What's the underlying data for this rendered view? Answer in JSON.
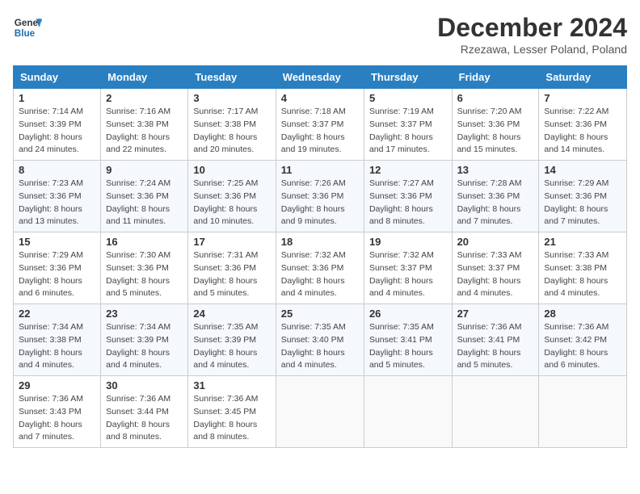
{
  "header": {
    "logo_general": "General",
    "logo_blue": "Blue",
    "month_title": "December 2024",
    "location": "Rzezawa, Lesser Poland, Poland"
  },
  "days_of_week": [
    "Sunday",
    "Monday",
    "Tuesday",
    "Wednesday",
    "Thursday",
    "Friday",
    "Saturday"
  ],
  "weeks": [
    [
      {
        "day": "1",
        "sunrise": "Sunrise: 7:14 AM",
        "sunset": "Sunset: 3:39 PM",
        "daylight": "Daylight: 8 hours and 24 minutes."
      },
      {
        "day": "2",
        "sunrise": "Sunrise: 7:16 AM",
        "sunset": "Sunset: 3:38 PM",
        "daylight": "Daylight: 8 hours and 22 minutes."
      },
      {
        "day": "3",
        "sunrise": "Sunrise: 7:17 AM",
        "sunset": "Sunset: 3:38 PM",
        "daylight": "Daylight: 8 hours and 20 minutes."
      },
      {
        "day": "4",
        "sunrise": "Sunrise: 7:18 AM",
        "sunset": "Sunset: 3:37 PM",
        "daylight": "Daylight: 8 hours and 19 minutes."
      },
      {
        "day": "5",
        "sunrise": "Sunrise: 7:19 AM",
        "sunset": "Sunset: 3:37 PM",
        "daylight": "Daylight: 8 hours and 17 minutes."
      },
      {
        "day": "6",
        "sunrise": "Sunrise: 7:20 AM",
        "sunset": "Sunset: 3:36 PM",
        "daylight": "Daylight: 8 hours and 15 minutes."
      },
      {
        "day": "7",
        "sunrise": "Sunrise: 7:22 AM",
        "sunset": "Sunset: 3:36 PM",
        "daylight": "Daylight: 8 hours and 14 minutes."
      }
    ],
    [
      {
        "day": "8",
        "sunrise": "Sunrise: 7:23 AM",
        "sunset": "Sunset: 3:36 PM",
        "daylight": "Daylight: 8 hours and 13 minutes."
      },
      {
        "day": "9",
        "sunrise": "Sunrise: 7:24 AM",
        "sunset": "Sunset: 3:36 PM",
        "daylight": "Daylight: 8 hours and 11 minutes."
      },
      {
        "day": "10",
        "sunrise": "Sunrise: 7:25 AM",
        "sunset": "Sunset: 3:36 PM",
        "daylight": "Daylight: 8 hours and 10 minutes."
      },
      {
        "day": "11",
        "sunrise": "Sunrise: 7:26 AM",
        "sunset": "Sunset: 3:36 PM",
        "daylight": "Daylight: 8 hours and 9 minutes."
      },
      {
        "day": "12",
        "sunrise": "Sunrise: 7:27 AM",
        "sunset": "Sunset: 3:36 PM",
        "daylight": "Daylight: 8 hours and 8 minutes."
      },
      {
        "day": "13",
        "sunrise": "Sunrise: 7:28 AM",
        "sunset": "Sunset: 3:36 PM",
        "daylight": "Daylight: 8 hours and 7 minutes."
      },
      {
        "day": "14",
        "sunrise": "Sunrise: 7:29 AM",
        "sunset": "Sunset: 3:36 PM",
        "daylight": "Daylight: 8 hours and 7 minutes."
      }
    ],
    [
      {
        "day": "15",
        "sunrise": "Sunrise: 7:29 AM",
        "sunset": "Sunset: 3:36 PM",
        "daylight": "Daylight: 8 hours and 6 minutes."
      },
      {
        "day": "16",
        "sunrise": "Sunrise: 7:30 AM",
        "sunset": "Sunset: 3:36 PM",
        "daylight": "Daylight: 8 hours and 5 minutes."
      },
      {
        "day": "17",
        "sunrise": "Sunrise: 7:31 AM",
        "sunset": "Sunset: 3:36 PM",
        "daylight": "Daylight: 8 hours and 5 minutes."
      },
      {
        "day": "18",
        "sunrise": "Sunrise: 7:32 AM",
        "sunset": "Sunset: 3:36 PM",
        "daylight": "Daylight: 8 hours and 4 minutes."
      },
      {
        "day": "19",
        "sunrise": "Sunrise: 7:32 AM",
        "sunset": "Sunset: 3:37 PM",
        "daylight": "Daylight: 8 hours and 4 minutes."
      },
      {
        "day": "20",
        "sunrise": "Sunrise: 7:33 AM",
        "sunset": "Sunset: 3:37 PM",
        "daylight": "Daylight: 8 hours and 4 minutes."
      },
      {
        "day": "21",
        "sunrise": "Sunrise: 7:33 AM",
        "sunset": "Sunset: 3:38 PM",
        "daylight": "Daylight: 8 hours and 4 minutes."
      }
    ],
    [
      {
        "day": "22",
        "sunrise": "Sunrise: 7:34 AM",
        "sunset": "Sunset: 3:38 PM",
        "daylight": "Daylight: 8 hours and 4 minutes."
      },
      {
        "day": "23",
        "sunrise": "Sunrise: 7:34 AM",
        "sunset": "Sunset: 3:39 PM",
        "daylight": "Daylight: 8 hours and 4 minutes."
      },
      {
        "day": "24",
        "sunrise": "Sunrise: 7:35 AM",
        "sunset": "Sunset: 3:39 PM",
        "daylight": "Daylight: 8 hours and 4 minutes."
      },
      {
        "day": "25",
        "sunrise": "Sunrise: 7:35 AM",
        "sunset": "Sunset: 3:40 PM",
        "daylight": "Daylight: 8 hours and 4 minutes."
      },
      {
        "day": "26",
        "sunrise": "Sunrise: 7:35 AM",
        "sunset": "Sunset: 3:41 PM",
        "daylight": "Daylight: 8 hours and 5 minutes."
      },
      {
        "day": "27",
        "sunrise": "Sunrise: 7:36 AM",
        "sunset": "Sunset: 3:41 PM",
        "daylight": "Daylight: 8 hours and 5 minutes."
      },
      {
        "day": "28",
        "sunrise": "Sunrise: 7:36 AM",
        "sunset": "Sunset: 3:42 PM",
        "daylight": "Daylight: 8 hours and 6 minutes."
      }
    ],
    [
      {
        "day": "29",
        "sunrise": "Sunrise: 7:36 AM",
        "sunset": "Sunset: 3:43 PM",
        "daylight": "Daylight: 8 hours and 7 minutes."
      },
      {
        "day": "30",
        "sunrise": "Sunrise: 7:36 AM",
        "sunset": "Sunset: 3:44 PM",
        "daylight": "Daylight: 8 hours and 8 minutes."
      },
      {
        "day": "31",
        "sunrise": "Sunrise: 7:36 AM",
        "sunset": "Sunset: 3:45 PM",
        "daylight": "Daylight: 8 hours and 8 minutes."
      },
      null,
      null,
      null,
      null
    ]
  ]
}
